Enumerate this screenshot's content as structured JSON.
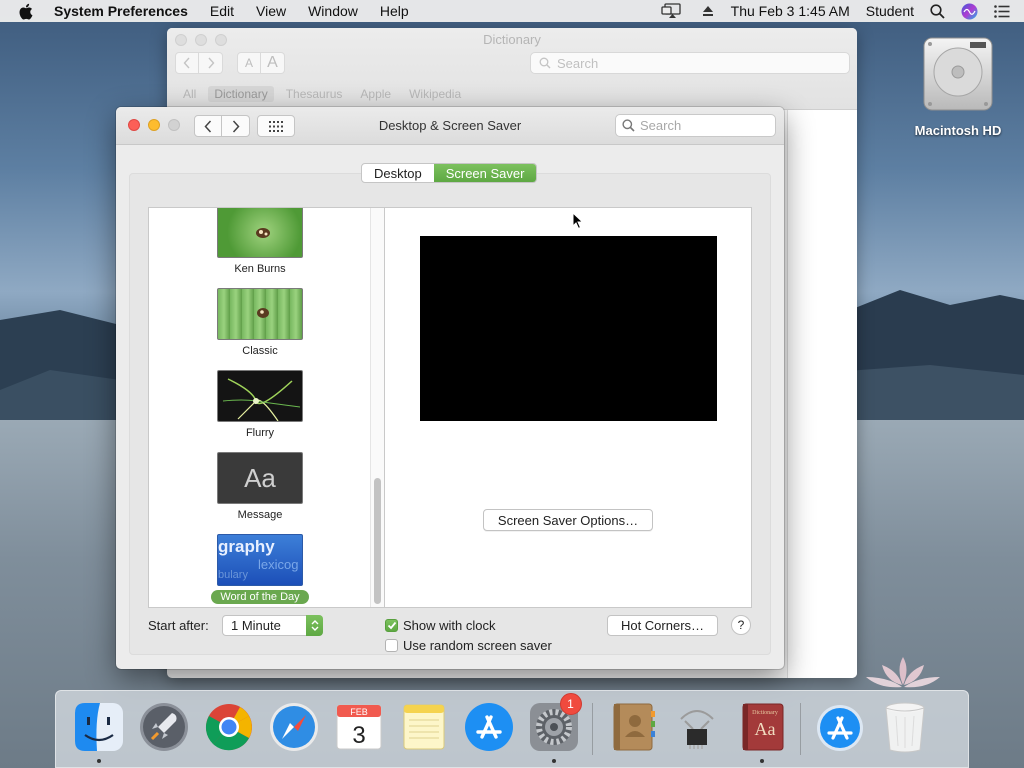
{
  "menubar": {
    "app_name": "System Preferences",
    "menus": [
      "Edit",
      "View",
      "Window",
      "Help"
    ],
    "clock": "Thu Feb 3  1:45 AM",
    "user": "Student"
  },
  "desktop": {
    "hd_label": "Macintosh HD"
  },
  "dictionary": {
    "title": "Dictionary",
    "font_small": "A",
    "font_large": "A",
    "search_placeholder": "Search",
    "tabs": [
      "All",
      "Dictionary",
      "Thesaurus",
      "Apple",
      "Wikipedia"
    ]
  },
  "window": {
    "title": "Desktop & Screen Saver",
    "search_placeholder": "Search",
    "segments": [
      "Desktop",
      "Screen Saver"
    ],
    "savers": [
      {
        "label": "Ken Burns"
      },
      {
        "label": "Classic"
      },
      {
        "label": "Flurry"
      },
      {
        "label": "Message",
        "thumb_text": "Aa"
      },
      {
        "label": "Word of the Day",
        "thumb_text_1": "graphy",
        "thumb_text_2": "lexicog",
        "thumb_text_3": "bulary"
      }
    ],
    "options_button": "Screen Saver Options…",
    "start_after_label": "Start after:",
    "start_after_value": "1 Minute",
    "show_clock_label": "Show with clock",
    "random_label": "Use random screen saver",
    "hot_corners_button": "Hot Corners…",
    "help_label": "?"
  },
  "dock": {
    "calendar_month": "FEB",
    "calendar_day": "3",
    "badge_count": "1",
    "dictionary_icon_text": "Aa",
    "dictionary_icon_caption": "Dictionary"
  }
}
